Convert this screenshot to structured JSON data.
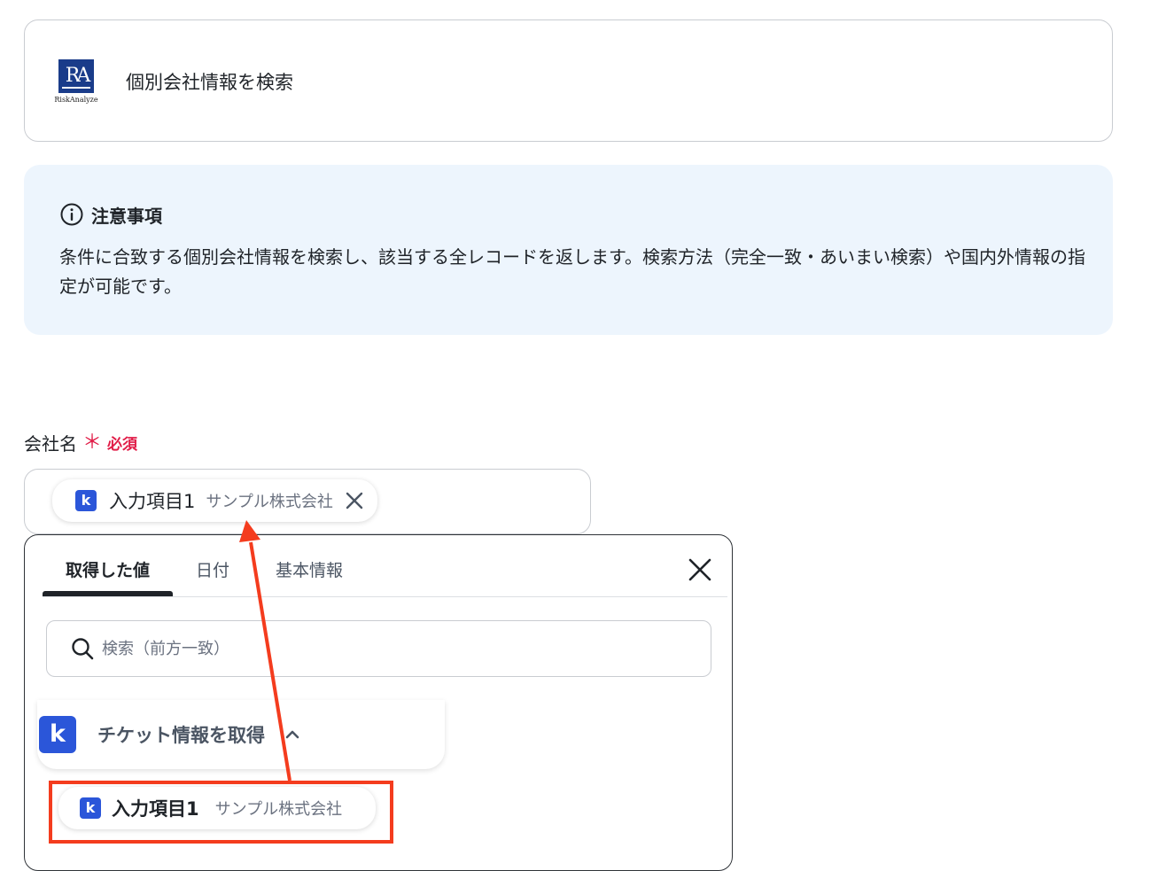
{
  "app": {
    "logo_text": "RA",
    "logo_caption": "RiskAnalyze",
    "action_title": "個別会社情報を検索"
  },
  "notice": {
    "icon": "info-icon",
    "title": "注意事項",
    "body": "条件に合致する個別会社情報を検索し、該当する全レコードを返します。検索方法（完全一致・あいまい検索）や国内外情報の指定が可能です。"
  },
  "field": {
    "label": "会社名",
    "required_mark": "＊",
    "required_text": "必須",
    "chip": {
      "icon": "kintone-icon",
      "label": "入力項目1",
      "value": "サンプル株式会社"
    }
  },
  "picker": {
    "tabs": [
      "取得した値",
      "日付",
      "基本情報"
    ],
    "active_tab": 0,
    "search_placeholder": "検索（前方一致）",
    "group_title": "チケット情報を取得",
    "item": {
      "label": "入力項目1",
      "value": "サンプル株式会社"
    }
  },
  "colors": {
    "accent_blue": "#2b56d9",
    "required_red": "#e11d48",
    "annotation_red": "#f43c1e",
    "notice_bg": "#edf5fd"
  }
}
